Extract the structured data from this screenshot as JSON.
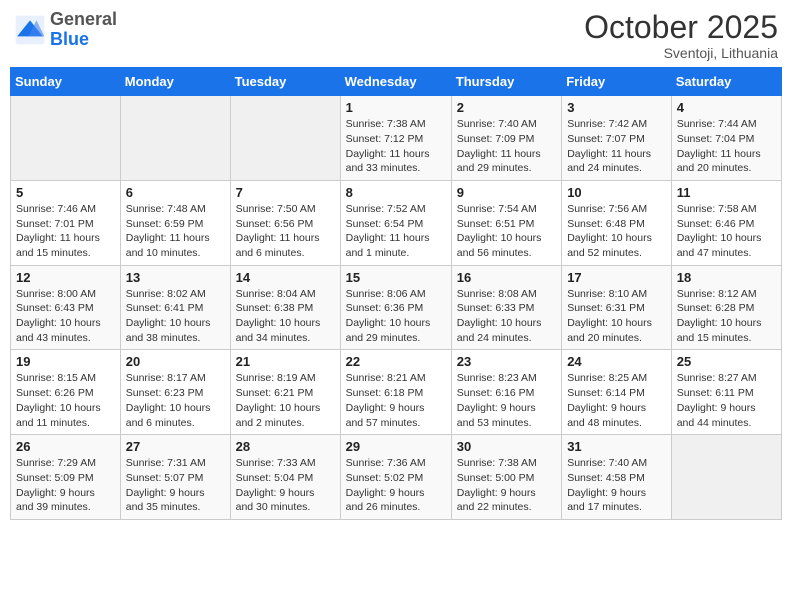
{
  "header": {
    "logo_general": "General",
    "logo_blue": "Blue",
    "month": "October 2025",
    "location": "Sventoji, Lithuania"
  },
  "days_of_week": [
    "Sunday",
    "Monday",
    "Tuesday",
    "Wednesday",
    "Thursday",
    "Friday",
    "Saturday"
  ],
  "weeks": [
    [
      {
        "day": "",
        "info": ""
      },
      {
        "day": "",
        "info": ""
      },
      {
        "day": "",
        "info": ""
      },
      {
        "day": "1",
        "info": "Sunrise: 7:38 AM\nSunset: 7:12 PM\nDaylight: 11 hours\nand 33 minutes."
      },
      {
        "day": "2",
        "info": "Sunrise: 7:40 AM\nSunset: 7:09 PM\nDaylight: 11 hours\nand 29 minutes."
      },
      {
        "day": "3",
        "info": "Sunrise: 7:42 AM\nSunset: 7:07 PM\nDaylight: 11 hours\nand 24 minutes."
      },
      {
        "day": "4",
        "info": "Sunrise: 7:44 AM\nSunset: 7:04 PM\nDaylight: 11 hours\nand 20 minutes."
      }
    ],
    [
      {
        "day": "5",
        "info": "Sunrise: 7:46 AM\nSunset: 7:01 PM\nDaylight: 11 hours\nand 15 minutes."
      },
      {
        "day": "6",
        "info": "Sunrise: 7:48 AM\nSunset: 6:59 PM\nDaylight: 11 hours\nand 10 minutes."
      },
      {
        "day": "7",
        "info": "Sunrise: 7:50 AM\nSunset: 6:56 PM\nDaylight: 11 hours\nand 6 minutes."
      },
      {
        "day": "8",
        "info": "Sunrise: 7:52 AM\nSunset: 6:54 PM\nDaylight: 11 hours\nand 1 minute."
      },
      {
        "day": "9",
        "info": "Sunrise: 7:54 AM\nSunset: 6:51 PM\nDaylight: 10 hours\nand 56 minutes."
      },
      {
        "day": "10",
        "info": "Sunrise: 7:56 AM\nSunset: 6:48 PM\nDaylight: 10 hours\nand 52 minutes."
      },
      {
        "day": "11",
        "info": "Sunrise: 7:58 AM\nSunset: 6:46 PM\nDaylight: 10 hours\nand 47 minutes."
      }
    ],
    [
      {
        "day": "12",
        "info": "Sunrise: 8:00 AM\nSunset: 6:43 PM\nDaylight: 10 hours\nand 43 minutes."
      },
      {
        "day": "13",
        "info": "Sunrise: 8:02 AM\nSunset: 6:41 PM\nDaylight: 10 hours\nand 38 minutes."
      },
      {
        "day": "14",
        "info": "Sunrise: 8:04 AM\nSunset: 6:38 PM\nDaylight: 10 hours\nand 34 minutes."
      },
      {
        "day": "15",
        "info": "Sunrise: 8:06 AM\nSunset: 6:36 PM\nDaylight: 10 hours\nand 29 minutes."
      },
      {
        "day": "16",
        "info": "Sunrise: 8:08 AM\nSunset: 6:33 PM\nDaylight: 10 hours\nand 24 minutes."
      },
      {
        "day": "17",
        "info": "Sunrise: 8:10 AM\nSunset: 6:31 PM\nDaylight: 10 hours\nand 20 minutes."
      },
      {
        "day": "18",
        "info": "Sunrise: 8:12 AM\nSunset: 6:28 PM\nDaylight: 10 hours\nand 15 minutes."
      }
    ],
    [
      {
        "day": "19",
        "info": "Sunrise: 8:15 AM\nSunset: 6:26 PM\nDaylight: 10 hours\nand 11 minutes."
      },
      {
        "day": "20",
        "info": "Sunrise: 8:17 AM\nSunset: 6:23 PM\nDaylight: 10 hours\nand 6 minutes."
      },
      {
        "day": "21",
        "info": "Sunrise: 8:19 AM\nSunset: 6:21 PM\nDaylight: 10 hours\nand 2 minutes."
      },
      {
        "day": "22",
        "info": "Sunrise: 8:21 AM\nSunset: 6:18 PM\nDaylight: 9 hours\nand 57 minutes."
      },
      {
        "day": "23",
        "info": "Sunrise: 8:23 AM\nSunset: 6:16 PM\nDaylight: 9 hours\nand 53 minutes."
      },
      {
        "day": "24",
        "info": "Sunrise: 8:25 AM\nSunset: 6:14 PM\nDaylight: 9 hours\nand 48 minutes."
      },
      {
        "day": "25",
        "info": "Sunrise: 8:27 AM\nSunset: 6:11 PM\nDaylight: 9 hours\nand 44 minutes."
      }
    ],
    [
      {
        "day": "26",
        "info": "Sunrise: 7:29 AM\nSunset: 5:09 PM\nDaylight: 9 hours\nand 39 minutes."
      },
      {
        "day": "27",
        "info": "Sunrise: 7:31 AM\nSunset: 5:07 PM\nDaylight: 9 hours\nand 35 minutes."
      },
      {
        "day": "28",
        "info": "Sunrise: 7:33 AM\nSunset: 5:04 PM\nDaylight: 9 hours\nand 30 minutes."
      },
      {
        "day": "29",
        "info": "Sunrise: 7:36 AM\nSunset: 5:02 PM\nDaylight: 9 hours\nand 26 minutes."
      },
      {
        "day": "30",
        "info": "Sunrise: 7:38 AM\nSunset: 5:00 PM\nDaylight: 9 hours\nand 22 minutes."
      },
      {
        "day": "31",
        "info": "Sunrise: 7:40 AM\nSunset: 4:58 PM\nDaylight: 9 hours\nand 17 minutes."
      },
      {
        "day": "",
        "info": ""
      }
    ]
  ]
}
